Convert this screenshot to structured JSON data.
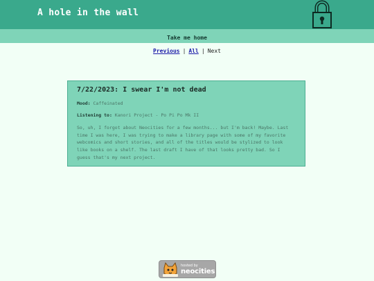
{
  "header": {
    "title": "A hole in the wall",
    "logo_icon": "padlock-icon"
  },
  "nav": {
    "home_label": "Take me home"
  },
  "pager": {
    "previous_label": "Previous",
    "all_label": "All",
    "next_label": "Next",
    "separator": "|"
  },
  "post": {
    "title": "7/22/2023: I swear I'm not dead",
    "mood_key": "Mood:",
    "mood_value": "Caffeinated",
    "listening_key": "Listening to:",
    "listening_value": "Kanori Project - Po Pi Po Mk II",
    "body": "So, uh, I forgot about Neocities for a few months... but I'm back! Maybe. Last time I was here, I was trying to make a library page with some of my favorite webcomics and short stories, and all of the titles would be stylized to look like books on a shelf. The last draft I have of that looks pretty bad. So I guess that's my next project."
  },
  "footer": {
    "badge_small": "hosted by",
    "badge_big": "neocities",
    "badge_icon": "neocities-cat-icon"
  },
  "colors": {
    "header_bg": "#3aa98c",
    "nav_bg": "#7fd4b8",
    "page_bg": "#f2fff6",
    "link": "#1a1aa8"
  }
}
